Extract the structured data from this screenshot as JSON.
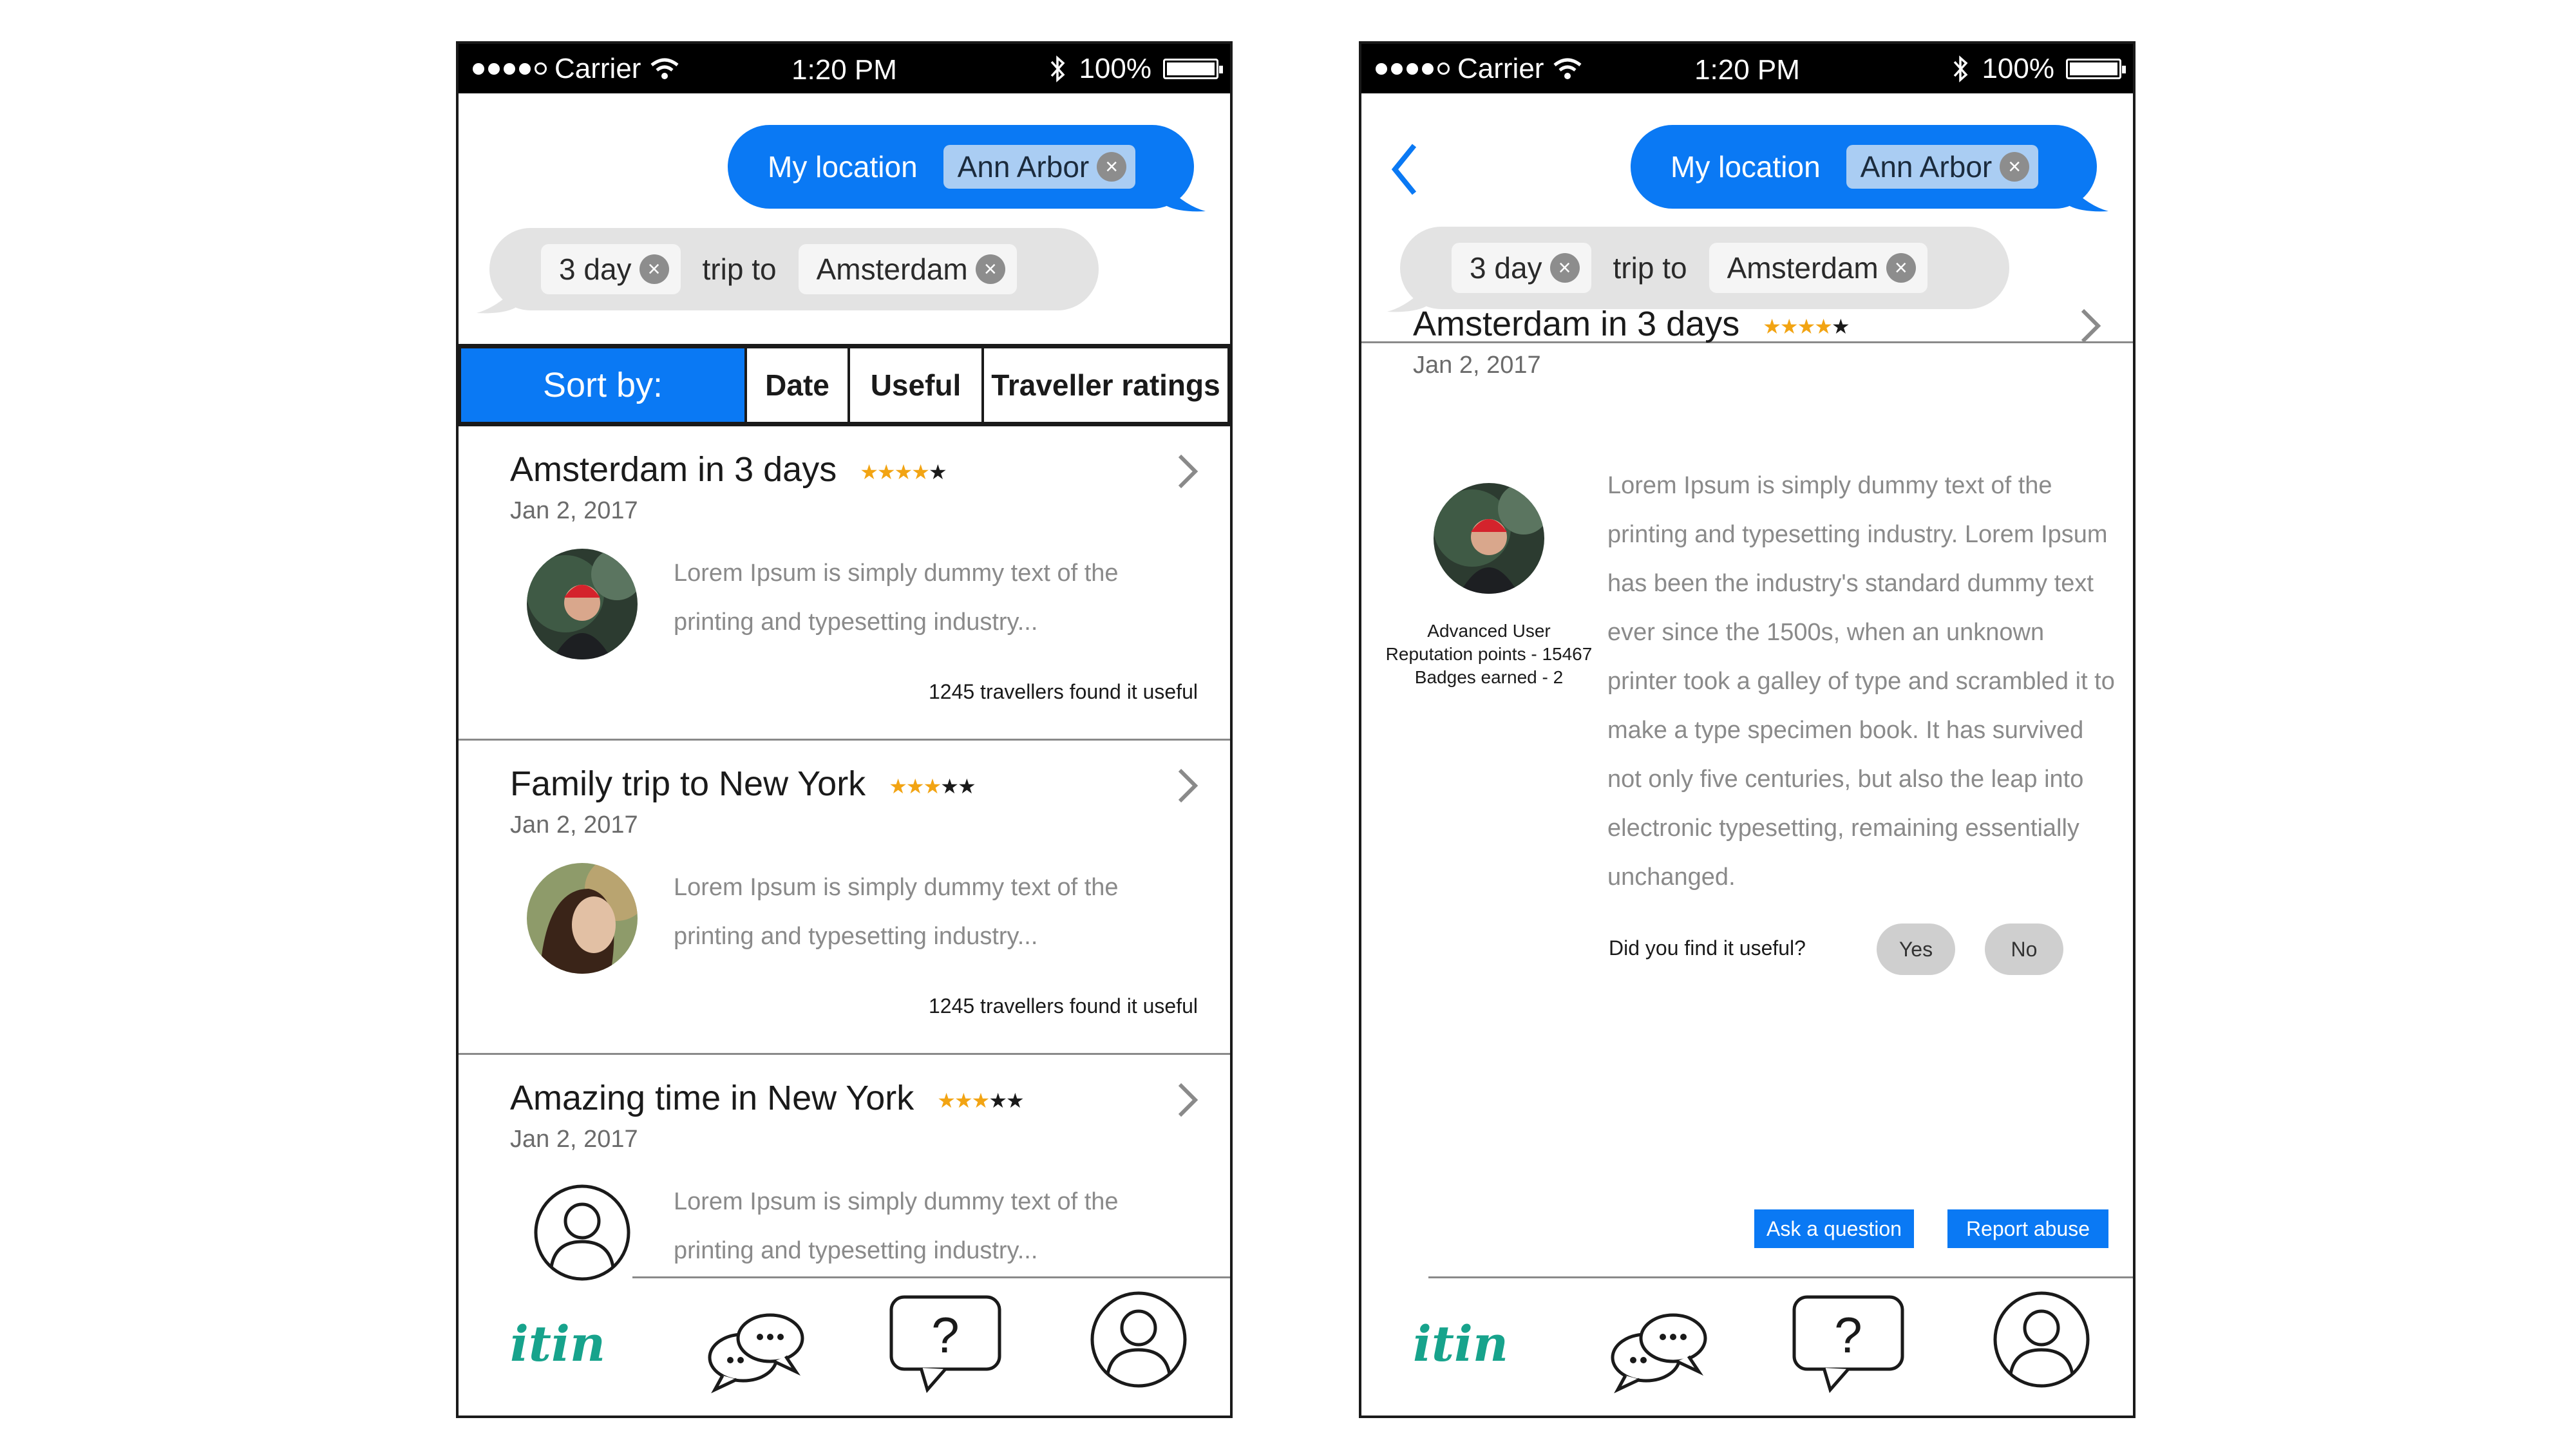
{
  "status_bar": {
    "carrier": "Carrier",
    "time": "1:20 PM",
    "battery": "100%"
  },
  "query": {
    "my_location_label": "My location",
    "location_chip": "Ann Arbor",
    "duration_chip": "3 day",
    "connector": "trip to",
    "destination_chip": "Amsterdam"
  },
  "sort": {
    "label": "Sort by:",
    "options": [
      "Date",
      "Useful",
      "Traveller ratings"
    ]
  },
  "cards": [
    {
      "title": "Amsterdam in 3 days",
      "date": "Jan 2, 2017",
      "stars_filled": 4,
      "stars_total": 5,
      "excerpt": "Lorem Ipsum is simply dummy text of the printing and typesetting industry...",
      "useful_count": "1245 travellers found it useful"
    },
    {
      "title": "Family trip to New York",
      "date": "Jan 2, 2017",
      "stars_filled": 3,
      "stars_total": 5,
      "excerpt": "Lorem Ipsum is simply dummy text of the printing and typesetting industry...",
      "useful_count": "1245 travellers found it useful"
    },
    {
      "title": "Amazing time in New York",
      "date": "Jan 2, 2017",
      "stars_filled": 3,
      "stars_total": 5,
      "excerpt": "Lorem Ipsum is simply dummy text of the printing and typesetting industry...",
      "useful_count": ""
    }
  ],
  "detail": {
    "title": "Amsterdam in 3 days",
    "date": "Jan 2, 2017",
    "stars_filled": 4,
    "stars_total": 5,
    "user_level": "Advanced User",
    "reputation": "Reputation points - 15467",
    "badges": "Badges earned - 2",
    "body": "Lorem Ipsum is simply dummy text of the printing and typesetting industry. Lorem Ipsum has been the industry's standard dummy text ever since the 1500s, when an unknown printer took a galley of type and scrambled it to make a type specimen book. It has survived not only five centuries, but also the leap into electronic typesetting, remaining essentially unchanged.",
    "useful_question": "Did you find it useful?",
    "yes_label": "Yes",
    "no_label": "No",
    "ask_label": "Ask a question",
    "report_label": "Report abuse"
  },
  "tabbar": {
    "logo": "itin",
    "icons": [
      "chat-icon",
      "help-icon",
      "profile-icon"
    ]
  },
  "colors": {
    "accent": "#0a79f4",
    "chip_light": "#aacdf3",
    "bubble_gray": "#e3e3e3",
    "star": "#f2a413",
    "logo": "#17a38c"
  }
}
